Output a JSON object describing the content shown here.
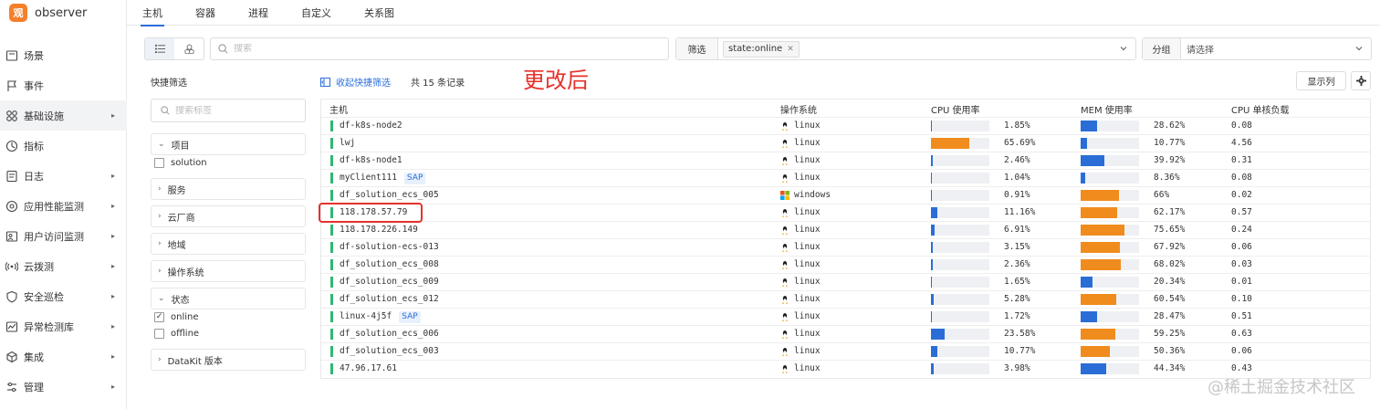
{
  "app": {
    "name": "observer",
    "logo_text": "观"
  },
  "sidebar": {
    "items": [
      {
        "label": "场景",
        "icon": "scene-icon",
        "expandable": false
      },
      {
        "label": "事件",
        "icon": "event-flag-icon",
        "expandable": false
      },
      {
        "label": "基础设施",
        "icon": "infrastructure-icon",
        "expandable": true,
        "active": true
      },
      {
        "label": "指标",
        "icon": "metric-icon",
        "expandable": false
      },
      {
        "label": "日志",
        "icon": "log-icon",
        "expandable": true
      },
      {
        "label": "应用性能监测",
        "icon": "apm-icon",
        "expandable": true
      },
      {
        "label": "用户访问监测",
        "icon": "rum-icon",
        "expandable": true
      },
      {
        "label": "云拨测",
        "icon": "dial-test-icon",
        "expandable": true
      },
      {
        "label": "安全巡检",
        "icon": "security-icon",
        "expandable": true
      },
      {
        "label": "异常检测库",
        "icon": "anomaly-icon",
        "expandable": true
      },
      {
        "label": "集成",
        "icon": "integration-icon",
        "expandable": true
      },
      {
        "label": "管理",
        "icon": "manage-icon",
        "expandable": true
      }
    ]
  },
  "tabs": [
    {
      "label": "主机",
      "active": true
    },
    {
      "label": "容器",
      "active": false
    },
    {
      "label": "进程",
      "active": false
    },
    {
      "label": "自定义",
      "active": false
    },
    {
      "label": "关系图",
      "active": false
    }
  ],
  "toolbar": {
    "search_placeholder": "搜索",
    "filter_label": "筛选",
    "filter_tag": "state:online",
    "group_label": "分组",
    "group_placeholder": "请选择"
  },
  "quick_filter": {
    "title": "快捷筛选",
    "search_placeholder": "搜索标签",
    "facets": [
      {
        "label": "项目",
        "expanded": true,
        "options": [
          {
            "label": "solution",
            "checked": false
          }
        ]
      },
      {
        "label": "服务",
        "expanded": false,
        "options": []
      },
      {
        "label": "云厂商",
        "expanded": false,
        "options": []
      },
      {
        "label": "地域",
        "expanded": false,
        "options": []
      },
      {
        "label": "操作系统",
        "expanded": false,
        "options": []
      },
      {
        "label": "状态",
        "expanded": true,
        "options": [
          {
            "label": "online",
            "checked": true
          },
          {
            "label": "offline",
            "checked": false
          }
        ]
      },
      {
        "label": "DataKit 版本",
        "expanded": false,
        "options": []
      }
    ]
  },
  "list_header": {
    "collapse_label": "收起快捷筛选",
    "records_label": "共 15 条记录",
    "annotation": "更改后",
    "columns_button": "显示列"
  },
  "table": {
    "columns": [
      "主机",
      "操作系统",
      "CPU 使用率",
      "MEM 使用率",
      "CPU 单核负载"
    ],
    "colors": {
      "cpu_low": "#2a6dd6",
      "cpu_high": "#f08c1e",
      "status_online": "#2eb872"
    },
    "rows": [
      {
        "host": "df-k8s-node2",
        "badge": "",
        "os": "linux",
        "cpu": "1.85%",
        "cpu_pct": 1.85,
        "mem": "28.62%",
        "mem_pct": 28.62,
        "load": "0.08"
      },
      {
        "host": "lwj",
        "badge": "",
        "os": "linux",
        "cpu": "65.69%",
        "cpu_pct": 65.69,
        "mem": "10.77%",
        "mem_pct": 10.77,
        "load": "4.56"
      },
      {
        "host": "df-k8s-node1",
        "badge": "",
        "os": "linux",
        "cpu": "2.46%",
        "cpu_pct": 2.46,
        "mem": "39.92%",
        "mem_pct": 39.92,
        "load": "0.31"
      },
      {
        "host": "myClient111",
        "badge": "SAP",
        "os": "linux",
        "cpu": "1.04%",
        "cpu_pct": 1.04,
        "mem": "8.36%",
        "mem_pct": 8.36,
        "load": "0.08"
      },
      {
        "host": "df_solution_ecs_005",
        "badge": "",
        "os": "windows",
        "cpu": "0.91%",
        "cpu_pct": 0.91,
        "mem": "66%",
        "mem_pct": 66,
        "load": "0.02"
      },
      {
        "host": "118.178.57.79",
        "badge": "",
        "os": "linux",
        "cpu": "11.16%",
        "cpu_pct": 11.16,
        "mem": "62.17%",
        "mem_pct": 62.17,
        "load": "0.57"
      },
      {
        "host": "118.178.226.149",
        "badge": "",
        "os": "linux",
        "cpu": "6.91%",
        "cpu_pct": 6.91,
        "mem": "75.65%",
        "mem_pct": 75.65,
        "load": "0.24"
      },
      {
        "host": "df-solution-ecs-013",
        "badge": "",
        "os": "linux",
        "cpu": "3.15%",
        "cpu_pct": 3.15,
        "mem": "67.92%",
        "mem_pct": 67.92,
        "load": "0.06"
      },
      {
        "host": "df_solution_ecs_008",
        "badge": "",
        "os": "linux",
        "cpu": "2.36%",
        "cpu_pct": 2.36,
        "mem": "68.02%",
        "mem_pct": 68.02,
        "load": "0.03"
      },
      {
        "host": "df_solution_ecs_009",
        "badge": "",
        "os": "linux",
        "cpu": "1.65%",
        "cpu_pct": 1.65,
        "mem": "20.34%",
        "mem_pct": 20.34,
        "load": "0.01"
      },
      {
        "host": "df_solution_ecs_012",
        "badge": "",
        "os": "linux",
        "cpu": "5.28%",
        "cpu_pct": 5.28,
        "mem": "60.54%",
        "mem_pct": 60.54,
        "load": "0.10"
      },
      {
        "host": "linux-4j5f",
        "badge": "SAP",
        "os": "linux",
        "cpu": "1.72%",
        "cpu_pct": 1.72,
        "mem": "28.47%",
        "mem_pct": 28.47,
        "load": "0.51"
      },
      {
        "host": "df_solution_ecs_006",
        "badge": "",
        "os": "linux",
        "cpu": "23.58%",
        "cpu_pct": 23.58,
        "mem": "59.25%",
        "mem_pct": 59.25,
        "load": "0.63"
      },
      {
        "host": "df_solution_ecs_003",
        "badge": "",
        "os": "linux",
        "cpu": "10.77%",
        "cpu_pct": 10.77,
        "mem": "50.36%",
        "mem_pct": 50.36,
        "load": "0.06"
      },
      {
        "host": "47.96.17.61",
        "badge": "",
        "os": "linux",
        "cpu": "3.98%",
        "cpu_pct": 3.98,
        "mem": "44.34%",
        "mem_pct": 44.34,
        "load": "0.43"
      }
    ]
  },
  "watermark": "@稀土掘金技术社区"
}
